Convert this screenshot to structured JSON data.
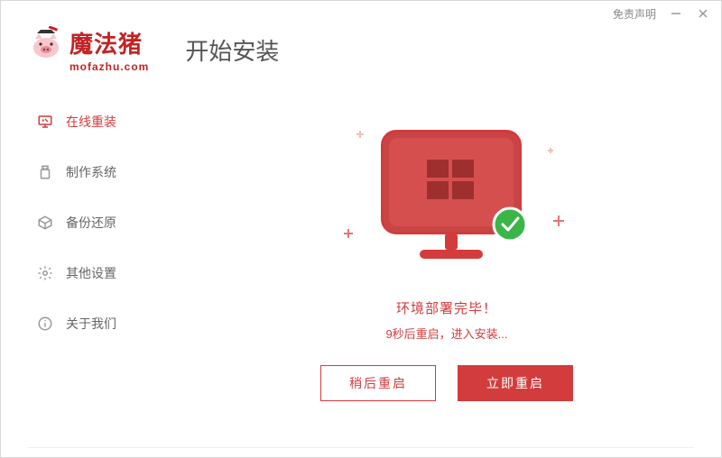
{
  "titlebar": {
    "disclaimer": "免责声明"
  },
  "brand": {
    "cn": "魔法猪",
    "en": "mofazhu.com"
  },
  "page_title": "开始安装",
  "sidebar": {
    "items": [
      {
        "label": "在线重装",
        "icon": "monitor-icon",
        "active": true
      },
      {
        "label": "制作系统",
        "icon": "usb-icon",
        "active": false
      },
      {
        "label": "备份还原",
        "icon": "box-icon",
        "active": false
      },
      {
        "label": "其他设置",
        "icon": "gear-icon",
        "active": false
      },
      {
        "label": "关于我们",
        "icon": "info-icon",
        "active": false
      }
    ]
  },
  "main": {
    "status_title": "环境部署完毕！",
    "status_sub": "9秒后重启，进入安装...",
    "later_btn": "稍后重启",
    "now_btn": "立即重启"
  },
  "colors": {
    "accent": "#d23c3c",
    "success": "#3bb54a"
  }
}
